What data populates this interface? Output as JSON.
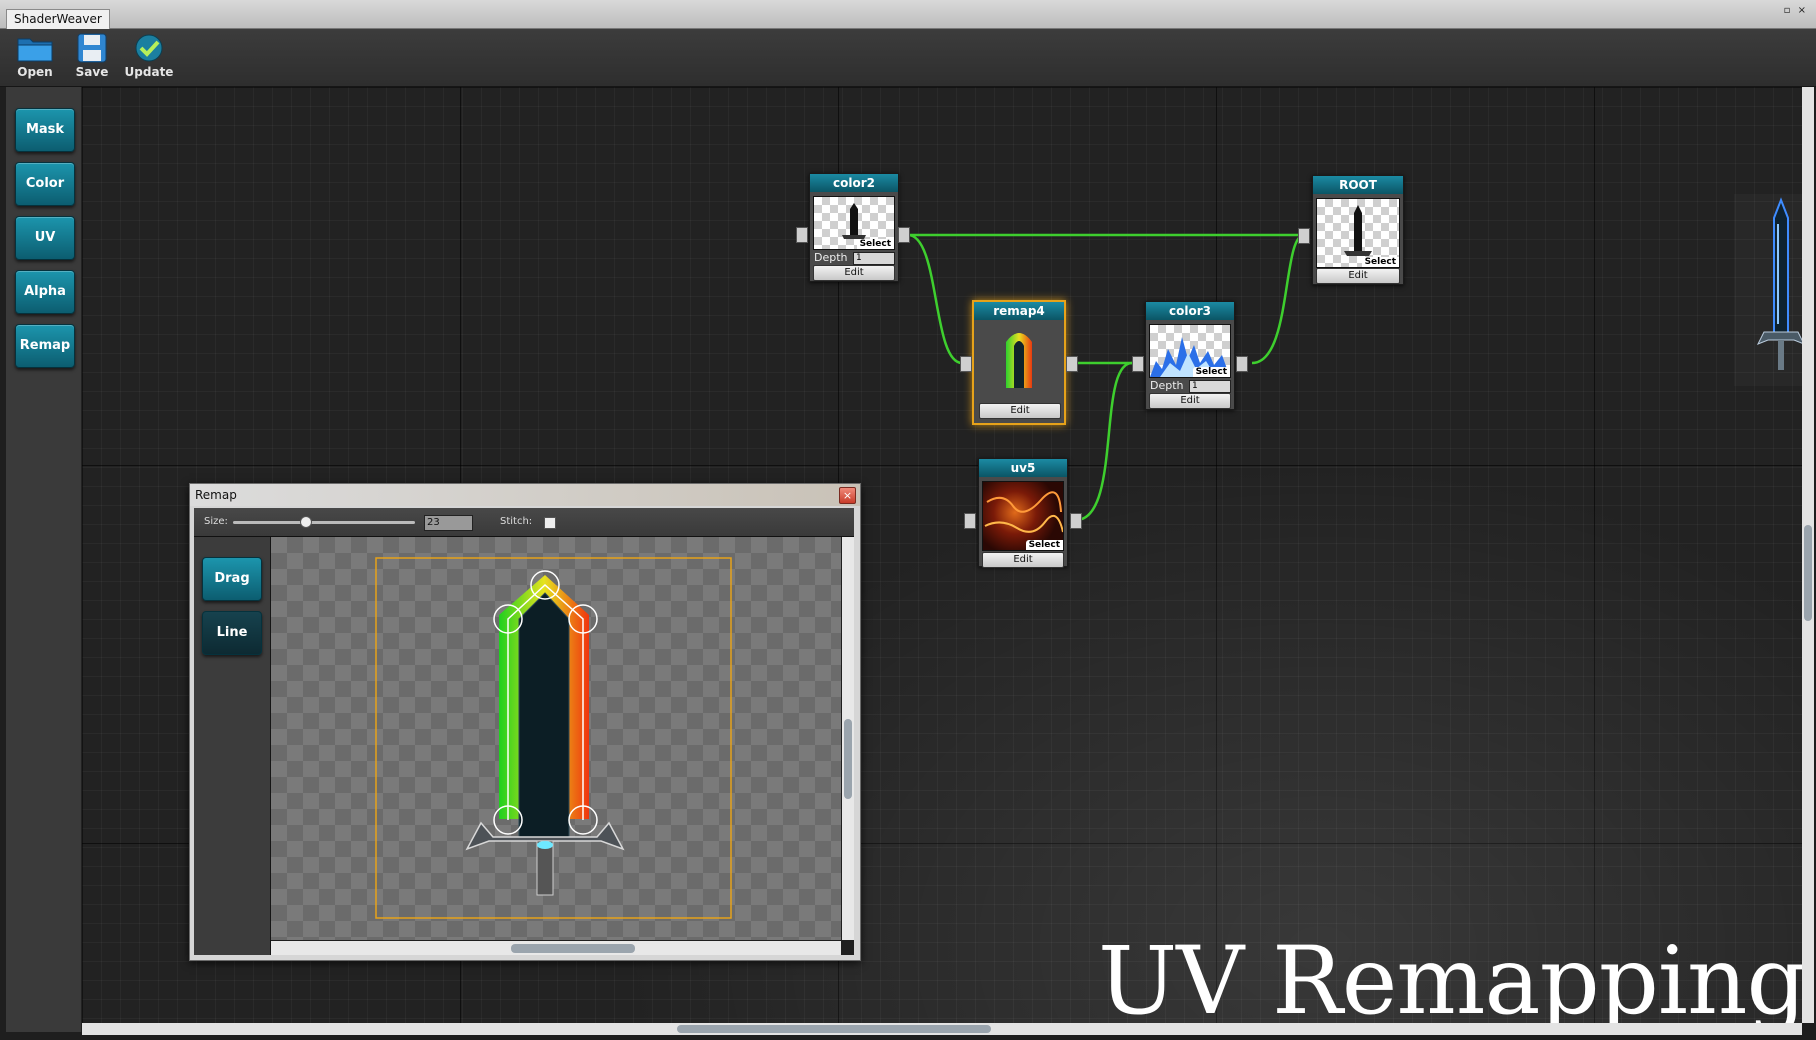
{
  "window": {
    "title": "ShaderWeaver",
    "controls": "▫ ×"
  },
  "toolbar": {
    "open_label": "Open",
    "save_label": "Save",
    "update_label": "Update"
  },
  "sidebar": {
    "items": [
      {
        "label": "Mask"
      },
      {
        "label": "Color"
      },
      {
        "label": "UV"
      },
      {
        "label": "Alpha"
      },
      {
        "label": "Remap"
      }
    ]
  },
  "nodes": {
    "color2": {
      "title": "color2",
      "select": "Select",
      "depth_label": "Depth",
      "depth_value": "1",
      "edit": "Edit"
    },
    "root": {
      "title": "ROOT",
      "select": "Select",
      "edit": "Edit"
    },
    "remap4": {
      "title": "remap4",
      "edit": "Edit"
    },
    "color3": {
      "title": "color3",
      "select": "Select",
      "depth_label": "Depth",
      "depth_value": "1",
      "edit": "Edit"
    },
    "uv5": {
      "title": "uv5",
      "select": "Select",
      "edit": "Edit"
    }
  },
  "remap_window": {
    "title": "Remap",
    "close": "×",
    "size_label": "Size:",
    "size_value": "23",
    "stitch_label": "Stitch:",
    "tools": [
      {
        "label": "Drag"
      },
      {
        "label": "Line"
      }
    ]
  },
  "overlay": {
    "title": "UV Remapping"
  },
  "colors": {
    "accent": "#0f7f97",
    "connection": "#3ecf2e",
    "selected_node_border": "#e6a21a"
  }
}
